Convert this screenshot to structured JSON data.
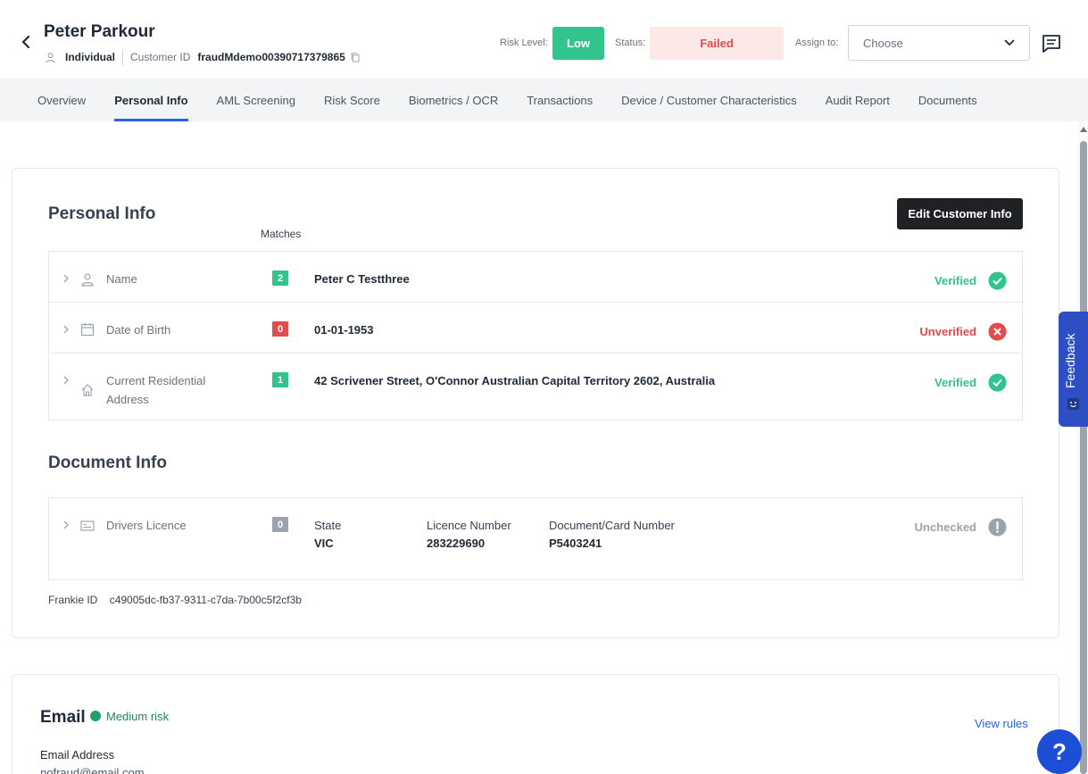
{
  "header": {
    "customer_name": "Peter Parkour",
    "entity_type": "Individual",
    "customer_id_label": "Customer ID",
    "customer_id": "fraudMdemo00390717379865",
    "risk_level_label": "Risk Level:",
    "risk_level": "Low",
    "status_label": "Status:",
    "status": "Failed",
    "assign_label": "Assign to:",
    "assign_placeholder": "Choose"
  },
  "tabs": [
    {
      "label": "Overview"
    },
    {
      "label": "Personal Info"
    },
    {
      "label": "AML Screening"
    },
    {
      "label": "Risk Score"
    },
    {
      "label": "Biometrics / OCR"
    },
    {
      "label": "Transactions"
    },
    {
      "label": "Device / Customer Characteristics"
    },
    {
      "label": "Audit Report"
    },
    {
      "label": "Documents"
    }
  ],
  "active_tab": "Personal Info",
  "personal_info": {
    "title": "Personal Info",
    "edit_button": "Edit Customer Info",
    "matches_header": "Matches",
    "rows": [
      {
        "label": "Name",
        "matches": "2",
        "value": "Peter C Testthree",
        "status": "Verified"
      },
      {
        "label": "Date of Birth",
        "matches": "0",
        "value": "01-01-1953",
        "status": "Unverified"
      },
      {
        "label": "Current Residential Address",
        "matches": "1",
        "value": "42 Scrivener Street, O'Connor Australian Capital Territory 2602, Australia",
        "status": "Verified"
      }
    ]
  },
  "document_info": {
    "title": "Document Info",
    "doc_label": "Drivers Licence",
    "matches": "0",
    "state_label": "State",
    "state_value": "VIC",
    "licence_label": "Licence Number",
    "licence_value": "283229690",
    "card_label": "Document/Card Number",
    "card_value": "P5403241",
    "status": "Unchecked",
    "frankie_label": "Frankie ID",
    "frankie_id": "c49005dc-fb37-9311-c7da-7b00c5f2cf3b"
  },
  "email": {
    "title": "Email",
    "risk": "Medium risk",
    "view_rules": "View rules",
    "address_label": "Email Address",
    "address_value": "nofraud@email.com"
  },
  "feedback_label": "Feedback",
  "help_label": "?",
  "colors": {
    "verified": "#31c48d",
    "unverified": "#e24c4c",
    "unchecked": "#9ca3af",
    "accent": "#2563eb"
  }
}
